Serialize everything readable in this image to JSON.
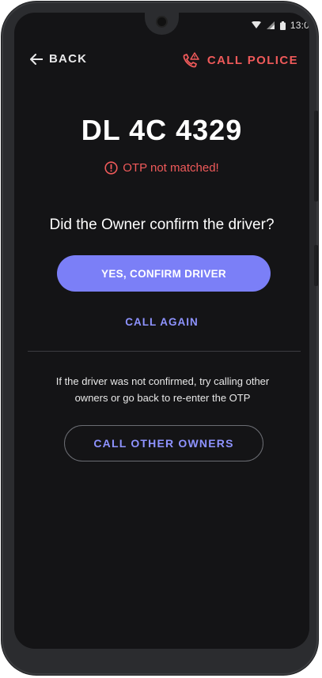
{
  "status": {
    "time": "13:0"
  },
  "topbar": {
    "back_label": "BACK",
    "police_label": "CALL POLICE"
  },
  "vehicle": {
    "plate": "DL 4C 4329"
  },
  "otp": {
    "error": "OTP not matched!"
  },
  "prompt": {
    "question": "Did the Owner confirm the driver?"
  },
  "actions": {
    "confirm_label": "YES, CONFIRM DRIVER",
    "call_again_label": "CALL AGAIN",
    "info_text": "If the driver was not confirmed, try calling other owners or go back to re-enter the OTP",
    "call_others_label": "CALL OTHER OWNERS"
  },
  "colors": {
    "accent": "#7b7ff7",
    "danger": "#f05a5a",
    "background": "#141416"
  }
}
